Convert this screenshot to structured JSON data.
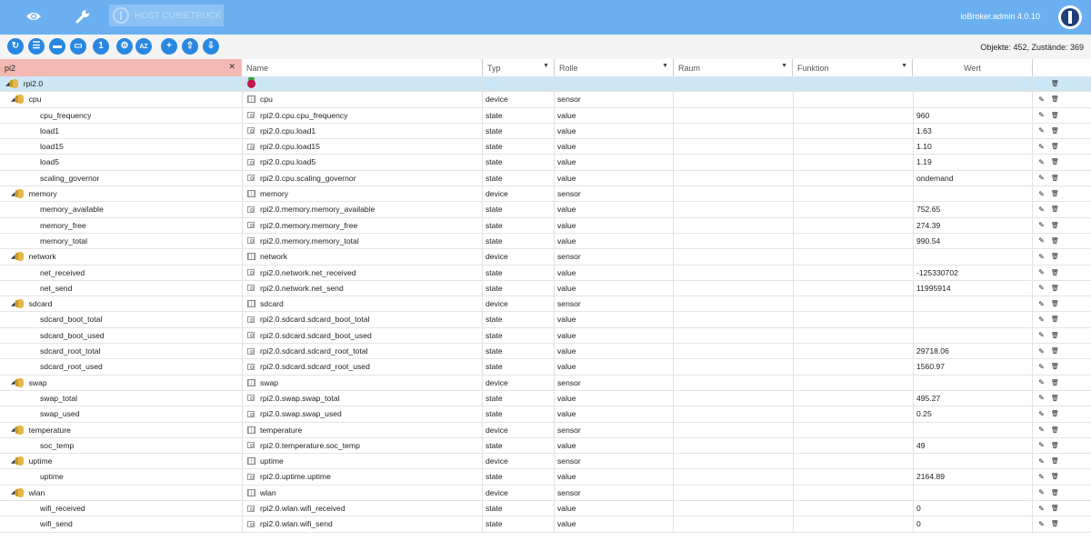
{
  "header": {
    "icons": [
      "eye-icon",
      "wrench-icon"
    ],
    "host_label": "HOST CUBIETRUCK",
    "version": "ioBroker.admin 4.0.10"
  },
  "toolbar": {
    "buttons": [
      {
        "name": "refresh-button",
        "glyph": "↻"
      },
      {
        "name": "list-view-button",
        "glyph": "☰"
      },
      {
        "name": "collapse-folders-button",
        "glyph": "▬"
      },
      {
        "name": "expand-folders-button",
        "glyph": "▭"
      },
      {
        "name": "show-value-button",
        "glyph": "1"
      },
      {
        "name": "settings-button",
        "glyph": "⚙"
      },
      {
        "name": "sort-az-button",
        "glyph": "AZ"
      },
      {
        "name": "add-object-button",
        "glyph": "+"
      },
      {
        "name": "upload-button",
        "glyph": "⇧"
      },
      {
        "name": "download-button",
        "glyph": "⇩"
      }
    ],
    "counts": "Objekte: 452, Zustände: 369"
  },
  "columns": {
    "filter_value": "pi2",
    "name": "Name",
    "typ": "Typ",
    "rolle": "Rolle",
    "raum": "Raum",
    "funktion": "Funktion",
    "wert": "Wert"
  },
  "rows": [
    {
      "level": 0,
      "kind": "folder",
      "label": "rpi2.0",
      "name": "",
      "typ": "",
      "rolle": "",
      "wert": "",
      "icon": "raspberry",
      "selected": true
    },
    {
      "level": 1,
      "kind": "folder",
      "label": "cpu",
      "name": "cpu",
      "typ": "device",
      "rolle": "sensor",
      "wert": "",
      "icon": "device"
    },
    {
      "level": 2,
      "kind": "leaf",
      "label": "cpu_frequency",
      "name": "rpi2.0.cpu.cpu_frequency",
      "typ": "state",
      "rolle": "value",
      "wert": "960",
      "icon": "state"
    },
    {
      "level": 2,
      "kind": "leaf",
      "label": "load1",
      "name": "rpi2.0.cpu.load1",
      "typ": "state",
      "rolle": "value",
      "wert": "1.63",
      "icon": "state"
    },
    {
      "level": 2,
      "kind": "leaf",
      "label": "load15",
      "name": "rpi2.0.cpu.load15",
      "typ": "state",
      "rolle": "value",
      "wert": "1.10",
      "icon": "state"
    },
    {
      "level": 2,
      "kind": "leaf",
      "label": "load5",
      "name": "rpi2.0.cpu.load5",
      "typ": "state",
      "rolle": "value",
      "wert": "1.19",
      "icon": "state"
    },
    {
      "level": 2,
      "kind": "leaf",
      "label": "scaling_governor",
      "name": "rpi2.0.cpu.scaling_governor",
      "typ": "state",
      "rolle": "value",
      "wert": "ondemand",
      "icon": "state"
    },
    {
      "level": 1,
      "kind": "folder",
      "label": "memory",
      "name": "memory",
      "typ": "device",
      "rolle": "sensor",
      "wert": "",
      "icon": "device"
    },
    {
      "level": 2,
      "kind": "leaf",
      "label": "memory_available",
      "name": "rpi2.0.memory.memory_available",
      "typ": "state",
      "rolle": "value",
      "wert": "752.65",
      "icon": "state"
    },
    {
      "level": 2,
      "kind": "leaf",
      "label": "memory_free",
      "name": "rpi2.0.memory.memory_free",
      "typ": "state",
      "rolle": "value",
      "wert": "274.39",
      "icon": "state"
    },
    {
      "level": 2,
      "kind": "leaf",
      "label": "memory_total",
      "name": "rpi2.0.memory.memory_total",
      "typ": "state",
      "rolle": "value",
      "wert": "990.54",
      "icon": "state"
    },
    {
      "level": 1,
      "kind": "folder",
      "label": "network",
      "name": "network",
      "typ": "device",
      "rolle": "sensor",
      "wert": "",
      "icon": "device"
    },
    {
      "level": 2,
      "kind": "leaf",
      "label": "net_received",
      "name": "rpi2.0.network.net_received",
      "typ": "state",
      "rolle": "value",
      "wert": "-125330702",
      "icon": "state"
    },
    {
      "level": 2,
      "kind": "leaf",
      "label": "net_send",
      "name": "rpi2.0.network.net_send",
      "typ": "state",
      "rolle": "value",
      "wert": "11995914",
      "icon": "state"
    },
    {
      "level": 1,
      "kind": "folder",
      "label": "sdcard",
      "name": "sdcard",
      "typ": "device",
      "rolle": "sensor",
      "wert": "",
      "icon": "device"
    },
    {
      "level": 2,
      "kind": "leaf",
      "label": "sdcard_boot_total",
      "name": "rpi2.0.sdcard.sdcard_boot_total",
      "typ": "state",
      "rolle": "value",
      "wert": "",
      "icon": "state"
    },
    {
      "level": 2,
      "kind": "leaf",
      "label": "sdcard_boot_used",
      "name": "rpi2.0.sdcard.sdcard_boot_used",
      "typ": "state",
      "rolle": "value",
      "wert": "",
      "icon": "state"
    },
    {
      "level": 2,
      "kind": "leaf",
      "label": "sdcard_root_total",
      "name": "rpi2.0.sdcard.sdcard_root_total",
      "typ": "state",
      "rolle": "value",
      "wert": "29718.06",
      "icon": "state"
    },
    {
      "level": 2,
      "kind": "leaf",
      "label": "sdcard_root_used",
      "name": "rpi2.0.sdcard.sdcard_root_used",
      "typ": "state",
      "rolle": "value",
      "wert": "1560.97",
      "icon": "state"
    },
    {
      "level": 1,
      "kind": "folder",
      "label": "swap",
      "name": "swap",
      "typ": "device",
      "rolle": "sensor",
      "wert": "",
      "icon": "device"
    },
    {
      "level": 2,
      "kind": "leaf",
      "label": "swap_total",
      "name": "rpi2.0.swap.swap_total",
      "typ": "state",
      "rolle": "value",
      "wert": "495.27",
      "icon": "state"
    },
    {
      "level": 2,
      "kind": "leaf",
      "label": "swap_used",
      "name": "rpi2.0.swap.swap_used",
      "typ": "state",
      "rolle": "value",
      "wert": "0.25",
      "icon": "state"
    },
    {
      "level": 1,
      "kind": "folder",
      "label": "temperature",
      "name": "temperature",
      "typ": "device",
      "rolle": "sensor",
      "wert": "",
      "icon": "device"
    },
    {
      "level": 2,
      "kind": "leaf",
      "label": "soc_temp",
      "name": "rpi2.0.temperature.soc_temp",
      "typ": "state",
      "rolle": "value",
      "wert": "49",
      "icon": "state"
    },
    {
      "level": 1,
      "kind": "folder",
      "label": "uptime",
      "name": "uptime",
      "typ": "device",
      "rolle": "sensor",
      "wert": "",
      "icon": "device"
    },
    {
      "level": 2,
      "kind": "leaf",
      "label": "uptime",
      "name": "rpi2.0.uptime.uptime",
      "typ": "state",
      "rolle": "value",
      "wert": "2164.89",
      "icon": "state"
    },
    {
      "level": 1,
      "kind": "folder",
      "label": "wlan",
      "name": "wlan",
      "typ": "device",
      "rolle": "sensor",
      "wert": "",
      "icon": "device"
    },
    {
      "level": 2,
      "kind": "leaf",
      "label": "wifi_received",
      "name": "rpi2.0.wlan.wifi_received",
      "typ": "state",
      "rolle": "value",
      "wert": "0",
      "icon": "state"
    },
    {
      "level": 2,
      "kind": "leaf",
      "label": "wifi_send",
      "name": "rpi2.0.wlan.wifi_send",
      "typ": "state",
      "rolle": "value",
      "wert": "0",
      "icon": "state"
    }
  ],
  "row_actions": {
    "edit_glyph": "✎",
    "delete_glyph": "🗑"
  }
}
